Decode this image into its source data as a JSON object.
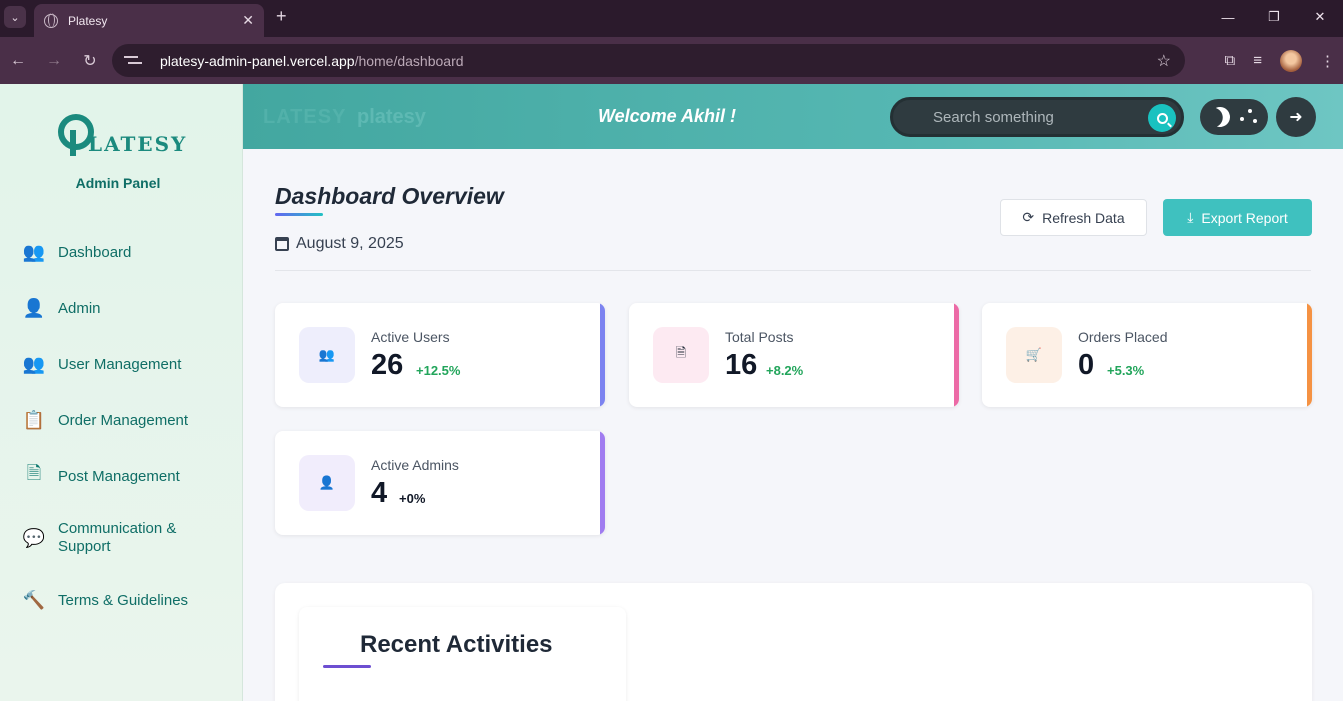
{
  "browser": {
    "tab_title": "Platesy",
    "url_host": "platesy-admin-panel.vercel.app",
    "url_path": "/home/dashboard"
  },
  "sidebar": {
    "logo_text": "LATESY",
    "panel_title": "Admin Panel",
    "items": [
      {
        "label": "Dashboard",
        "icon": "users-icon"
      },
      {
        "label": "Admin",
        "icon": "user-shield-icon"
      },
      {
        "label": "User Management",
        "icon": "users-icon"
      },
      {
        "label": "Order Management",
        "icon": "clipboard-list-icon"
      },
      {
        "label": "Post Management",
        "icon": "file-icon"
      },
      {
        "label": "Communication &",
        "label2": "Support",
        "icon": "chat-icon"
      },
      {
        "label": "Terms & Guidelines",
        "icon": "gavel-icon"
      }
    ]
  },
  "header": {
    "ghost_logo": "LATESY",
    "ghost_word": "platesy",
    "welcome": "Welcome Akhil !",
    "search_placeholder": "Search something"
  },
  "main": {
    "title": "Dashboard Overview",
    "date": "August 9, 2025",
    "refresh_label": "Refresh Data",
    "export_label": "Export Report",
    "stats": [
      {
        "label": "Active Users",
        "value": "26",
        "delta": "+12.5%",
        "accent": "#7c83f0",
        "bg": "#eeeefc"
      },
      {
        "label": "Total Posts",
        "value": "16",
        "delta": "+8.2%",
        "accent": "#ec6aa6",
        "bg": "#fdeaf2"
      },
      {
        "label": "Orders Placed",
        "value": "0",
        "delta": "+5.3%",
        "accent": "#f59243",
        "bg": "#fdf0e6"
      },
      {
        "label": "Active Admins",
        "value": "4",
        "delta": "+0%",
        "accent": "#a07cf0",
        "bg": "#f1edfc"
      }
    ],
    "recent_title": "Recent Activities"
  }
}
